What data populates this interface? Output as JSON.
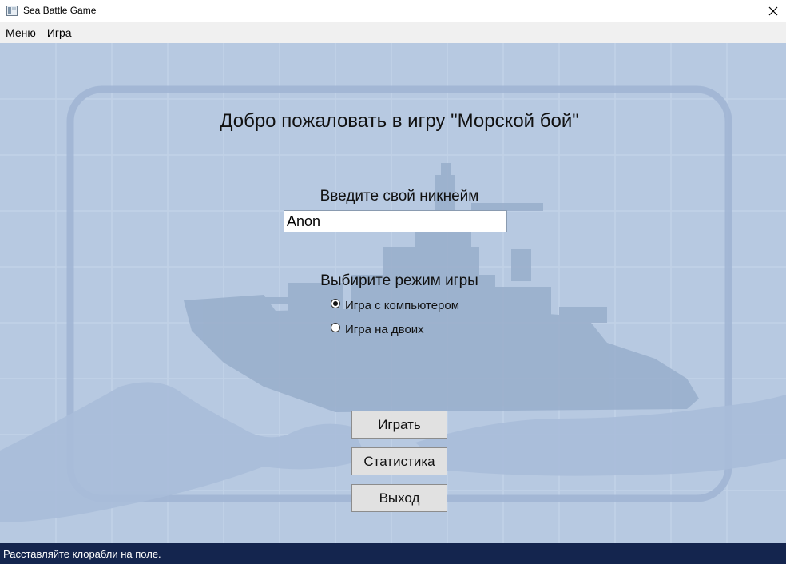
{
  "window": {
    "title": "Sea Battle Game"
  },
  "menu": {
    "items": [
      "Меню",
      "Игра"
    ]
  },
  "main": {
    "welcome": "Добро пожаловать в игру \"Морской бой\"",
    "nickname_label": "Введите свой никнейм",
    "nickname_value": "Anon",
    "mode_label": "Выбирите режим игры",
    "modes": [
      {
        "label": "Игра с компьютером",
        "selected": true
      },
      {
        "label": "Игра на двоих",
        "selected": false
      }
    ],
    "buttons": {
      "play": "Играть",
      "stats": "Статистика",
      "exit": "Выход"
    }
  },
  "status": {
    "text": "Расставляйте клорабли на поле."
  },
  "colors": {
    "background": "#b7c9e1",
    "status_bar": "#14254e",
    "menu_bar": "#f0f0f0"
  },
  "icons": {
    "app": "window-app-icon",
    "close": "close-icon"
  }
}
